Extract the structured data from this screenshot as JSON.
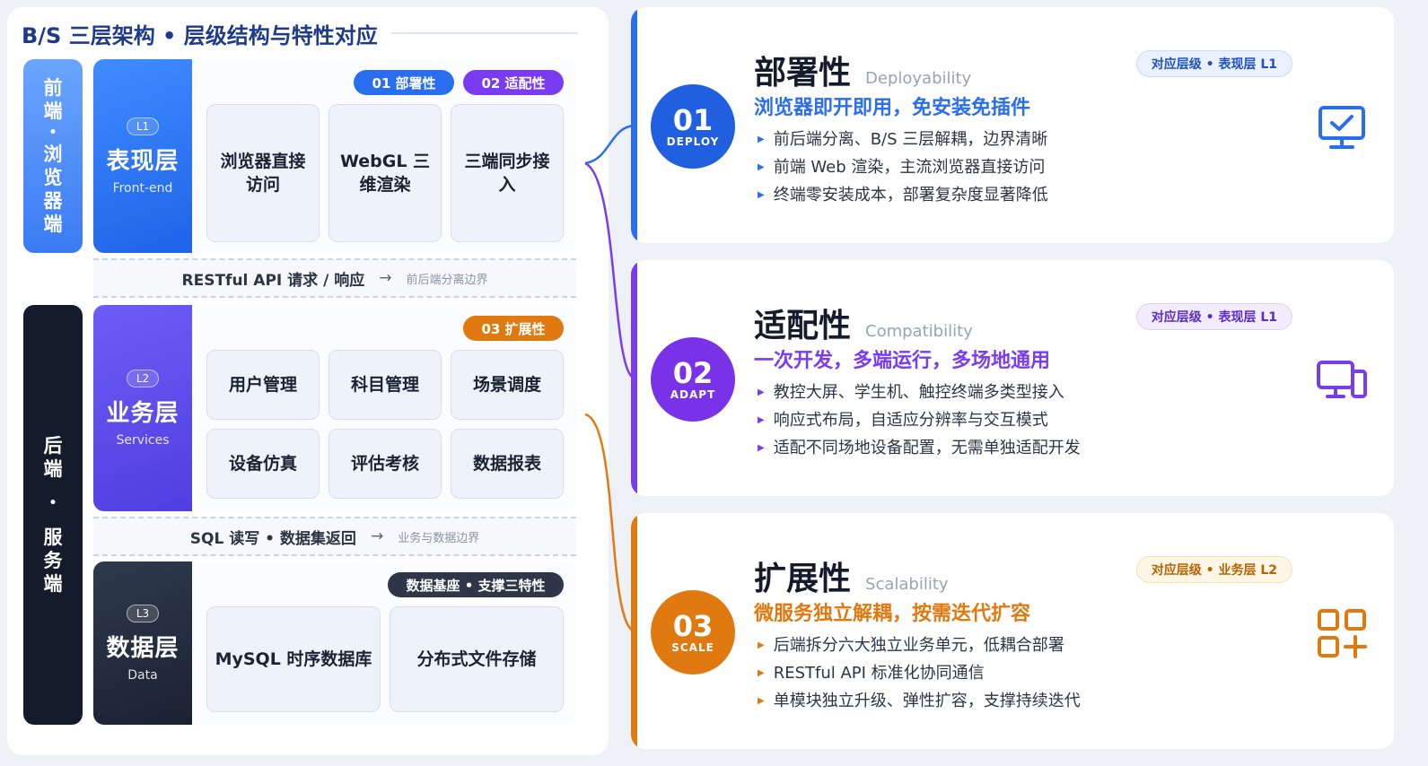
{
  "title": "B/S 三层架构 • 层级结构与特性对应",
  "sides": {
    "front": [
      "前",
      "端",
      "•",
      "浏",
      "览",
      "器",
      "端"
    ],
    "back": [
      "后",
      "端",
      "•",
      "服",
      "务",
      "端"
    ]
  },
  "layers": {
    "l1": {
      "badge": "L1",
      "name": "表现层",
      "sub": "Front-end",
      "pills": [
        "01 部署性",
        "02 适配性"
      ],
      "modules": [
        "浏览器直接访问",
        "WebGL 三维渲染",
        "三端同步接入"
      ]
    },
    "l2": {
      "badge": "L2",
      "name": "业务层",
      "sub": "Services",
      "pills": [
        "03 扩展性"
      ],
      "modules": [
        "用户管理",
        "科目管理",
        "场景调度",
        "设备仿真",
        "评估考核",
        "数据报表"
      ]
    },
    "l3": {
      "badge": "L3",
      "name": "数据层",
      "sub": "Data",
      "pills": [
        "数据基座 • 支撑三特性"
      ],
      "modules": [
        "MySQL 时序数据库",
        "分布式文件存储"
      ]
    }
  },
  "connectors": [
    {
      "main": "RESTful API 请求 / 响应",
      "arrow": "→",
      "note": "前后端分离边界"
    },
    {
      "main": "SQL 读写 • 数据集返回",
      "arrow": "→",
      "note": "业务与数据边界"
    }
  ],
  "cards": [
    {
      "num": "01",
      "word": "DEPLOY",
      "title": "部署性",
      "en": "Deployability",
      "badge": "对应层级 • 表现层 L1",
      "subtitle": "浏览器即开即用，免安装免插件",
      "bullets": [
        "前后端分离、B/S 三层解耦，边界清晰",
        "前端 Web 渲染，主流浏览器直接访问",
        "终端零安装成本，部署复杂度显著降低"
      ],
      "icon": "monitor-check-icon"
    },
    {
      "num": "02",
      "word": "ADAPT",
      "title": "适配性",
      "en": "Compatibility",
      "badge": "对应层级 • 表现层 L1",
      "subtitle": "一次开发，多端运行，多场地通用",
      "bullets": [
        "教控大屏、学生机、触控终端多类型接入",
        "响应式布局，自适应分辨率与交互模式",
        "适配不同场地设备配置，无需单独适配开发"
      ],
      "icon": "devices-icon"
    },
    {
      "num": "03",
      "word": "SCALE",
      "title": "扩展性",
      "en": "Scalability",
      "badge": "对应层级 • 业务层 L2",
      "subtitle": "微服务独立解耦，按需迭代扩容",
      "bullets": [
        "后端拆分六大独立业务单元，低耦合部署",
        "RESTful API 标准化协同通信",
        "单模块独立升级、弹性扩容，支撑持续迭代"
      ],
      "icon": "apps-add-icon"
    }
  ],
  "colors": {
    "blue": "#2a6ef0",
    "purple": "#7a3cf0",
    "orange": "#e07a10",
    "dark": "#1b2436",
    "navy": "#1e3a8a"
  }
}
